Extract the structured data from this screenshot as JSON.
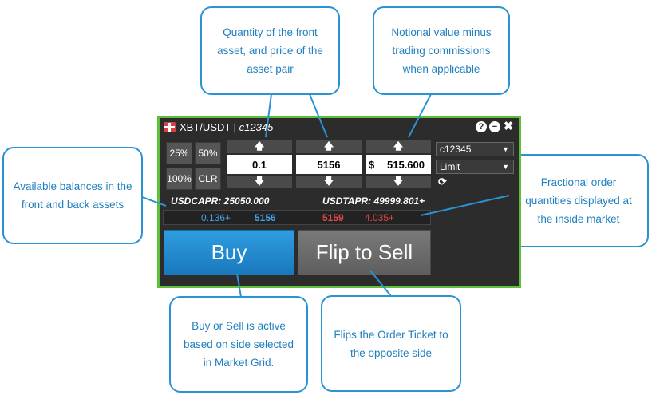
{
  "callouts": {
    "quantity_price": "Quantity of the front asset, and price of the asset pair",
    "notional": "Notional value minus trading commissions when applicable",
    "balances": "Available balances in the front and back assets",
    "fractional": "Fractional order quantities displayed at the inside market",
    "buy_sell": "Buy or Sell is active based on side selected in Market Grid.",
    "flip": "Flips the Order Ticket to the opposite side"
  },
  "ticket": {
    "title_pair": "XBT/USDT |",
    "title_account": "c12345",
    "icons": [
      "help-icon",
      "minimize-icon",
      "close-icon"
    ],
    "pct_buttons": [
      "25%",
      "50%",
      "100%",
      "CLR"
    ],
    "quantity": "0.1",
    "price": "5156",
    "notional_symbol": "$",
    "notional": "515.600",
    "up_arrow": "🡅",
    "down_arrow": "🡇",
    "account_select": "c12345",
    "order_type_select": "Limit",
    "balance_front": "USDCAPR: 25050.000",
    "balance_back": "USDTAPR: 49999.801+",
    "market": {
      "bid_qty": "0.136+",
      "bid_price": "5156",
      "ask_price": "5159",
      "ask_qty": "4.035+"
    },
    "buy_label": "Buy",
    "flip_label": "Flip to Sell"
  },
  "colors": {
    "border_green": "#5fbf3a",
    "callout_blue": "#2a93d5",
    "bid_blue": "#3fa3e8",
    "ask_red": "#e04848",
    "buy_blue": "#1f86cc"
  }
}
